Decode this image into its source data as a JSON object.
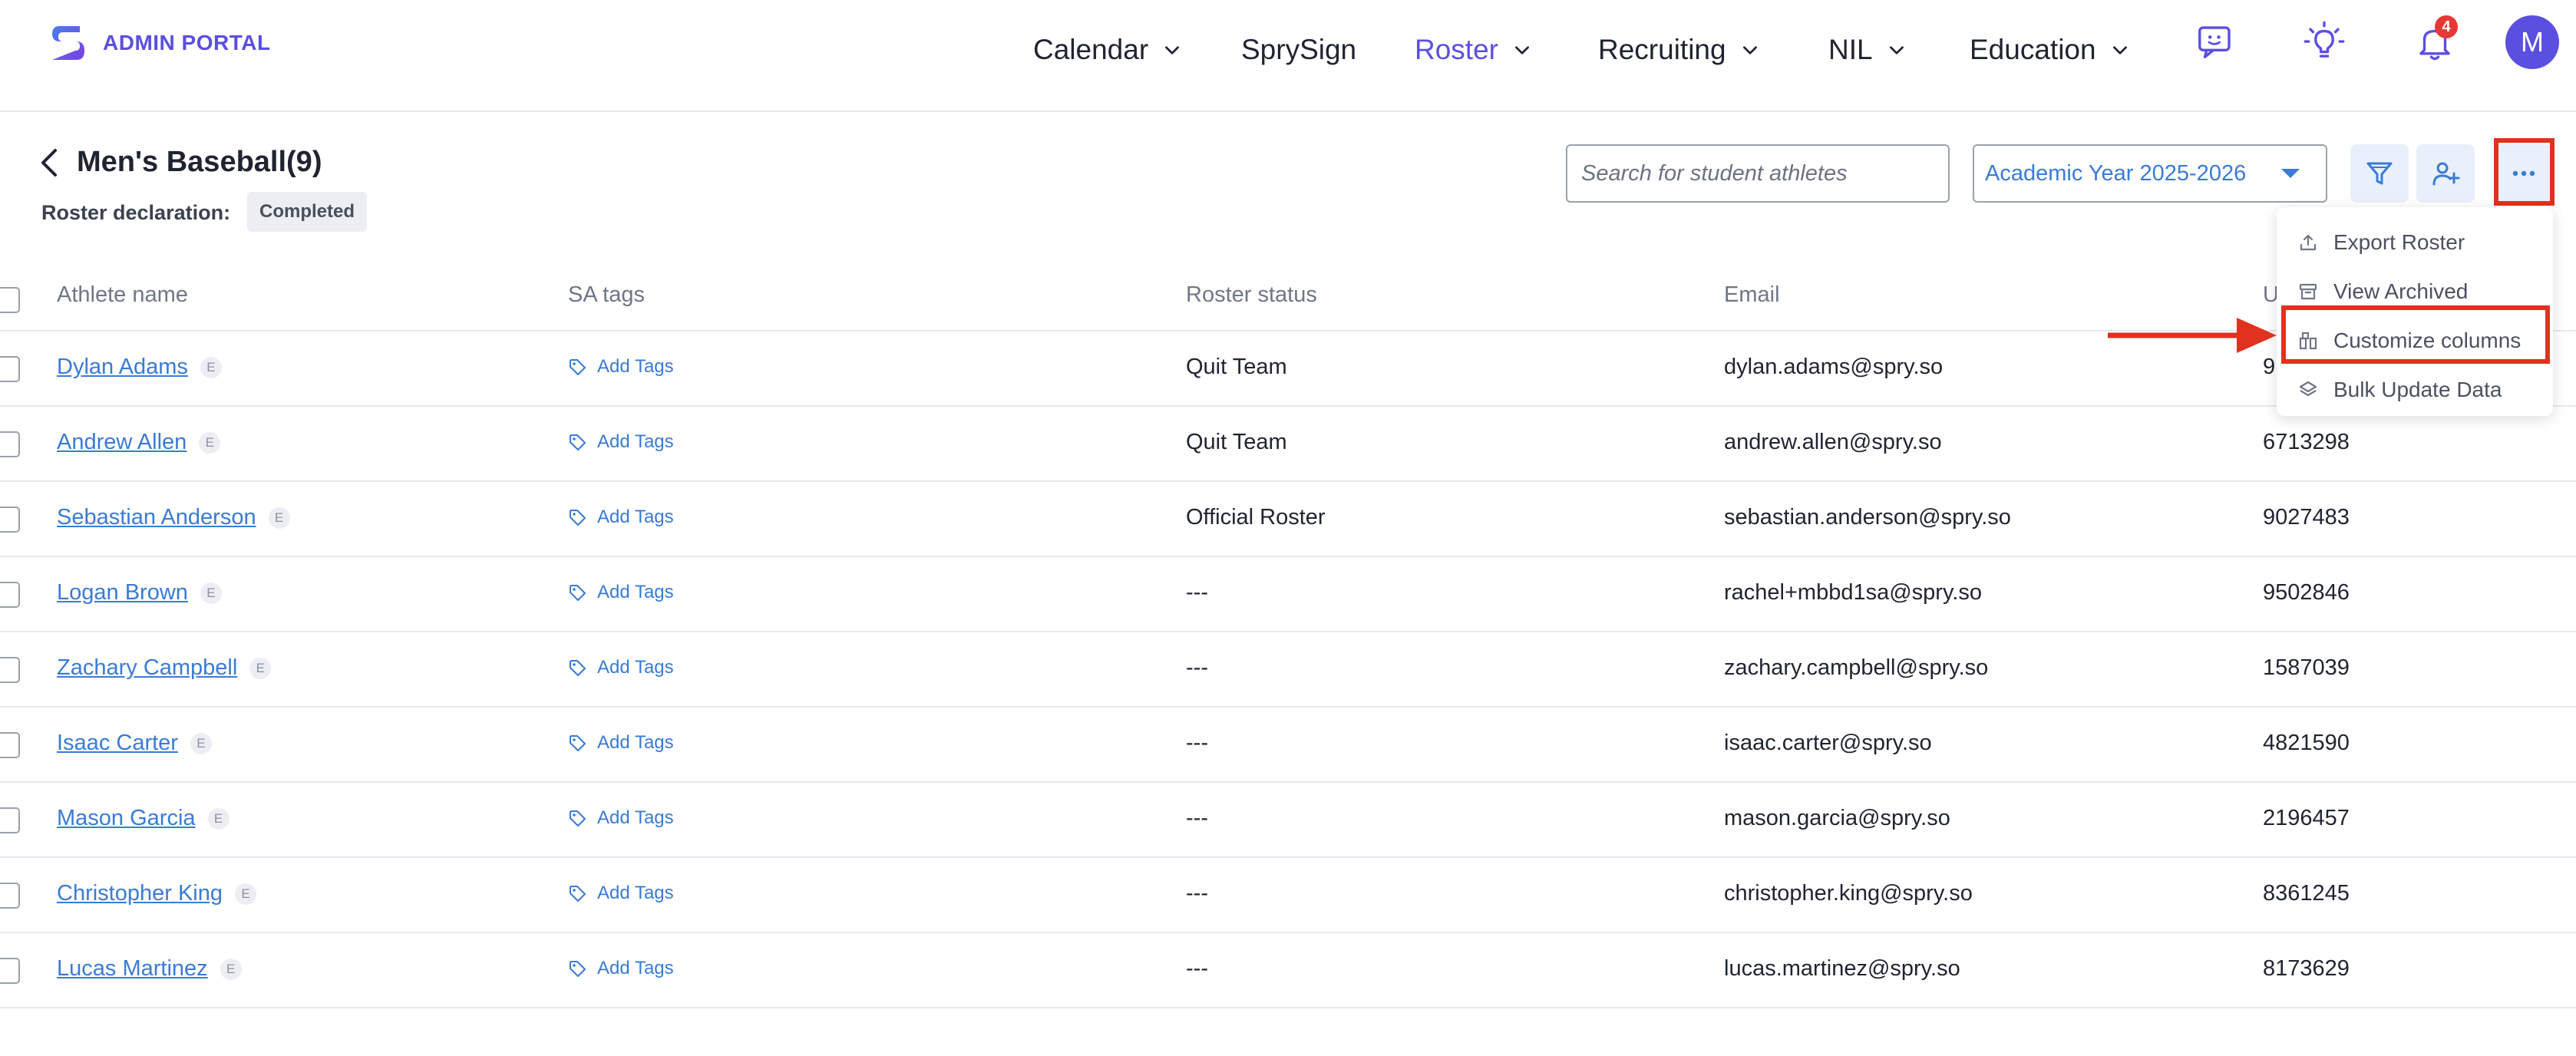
{
  "brand": {
    "name": "ADMIN PORTAL"
  },
  "nav": {
    "items": [
      {
        "label": "Calendar",
        "dropdown": true,
        "active": false
      },
      {
        "label": "SprySign",
        "dropdown": false,
        "active": false
      },
      {
        "label": "Roster",
        "dropdown": true,
        "active": true
      },
      {
        "label": "Recruiting",
        "dropdown": true,
        "active": false
      },
      {
        "label": "NIL",
        "dropdown": true,
        "active": false
      },
      {
        "label": "Education",
        "dropdown": true,
        "active": false
      }
    ],
    "icons": [
      "chat-icon",
      "lightbulb-icon",
      "bell-icon"
    ],
    "notification_count": "4",
    "avatar_initial": "M"
  },
  "header": {
    "title": "Men's Baseball(9)",
    "roster_declaration_label": "Roster declaration:",
    "roster_declaration_status": "Completed"
  },
  "toolbar": {
    "search_placeholder": "Search for student athletes",
    "academic_year": "Academic Year 2025-2026"
  },
  "menu": {
    "items": [
      {
        "label": "Export Roster",
        "icon": "export-icon"
      },
      {
        "label": "View Archived",
        "icon": "archive-icon"
      },
      {
        "label": "Customize columns",
        "icon": "columns-icon"
      },
      {
        "label": "Bulk Update Data",
        "icon": "layers-icon"
      }
    ]
  },
  "table": {
    "columns": [
      "Athlete name",
      "SA tags",
      "Roster status",
      "Email",
      "U"
    ],
    "add_tags_label": "Add Tags",
    "badge": "E",
    "rows": [
      {
        "name": "Dylan Adams",
        "status": "Quit Team",
        "email": "dylan.adams@spry.so",
        "id": "9"
      },
      {
        "name": "Andrew Allen",
        "status": "Quit Team",
        "email": "andrew.allen@spry.so",
        "id": "6713298"
      },
      {
        "name": "Sebastian Anderson",
        "status": "Official Roster",
        "email": "sebastian.anderson@spry.so",
        "id": "9027483"
      },
      {
        "name": "Logan Brown",
        "status": "---",
        "email": "rachel+mbbd1sa@spry.so",
        "id": "9502846"
      },
      {
        "name": "Zachary Campbell",
        "status": "---",
        "email": "zachary.campbell@spry.so",
        "id": "1587039"
      },
      {
        "name": "Isaac Carter",
        "status": "---",
        "email": "isaac.carter@spry.so",
        "id": "4821590"
      },
      {
        "name": "Mason Garcia",
        "status": "---",
        "email": "mason.garcia@spry.so",
        "id": "2196457"
      },
      {
        "name": "Christopher King",
        "status": "---",
        "email": "christopher.king@spry.so",
        "id": "8361245"
      },
      {
        "name": "Lucas Martinez",
        "status": "---",
        "email": "lucas.martinez@spry.so",
        "id": "8173629"
      }
    ]
  },
  "colors": {
    "accent": "#5b4fe0",
    "link": "#3a7bd5",
    "highlight": "#e0321e"
  }
}
